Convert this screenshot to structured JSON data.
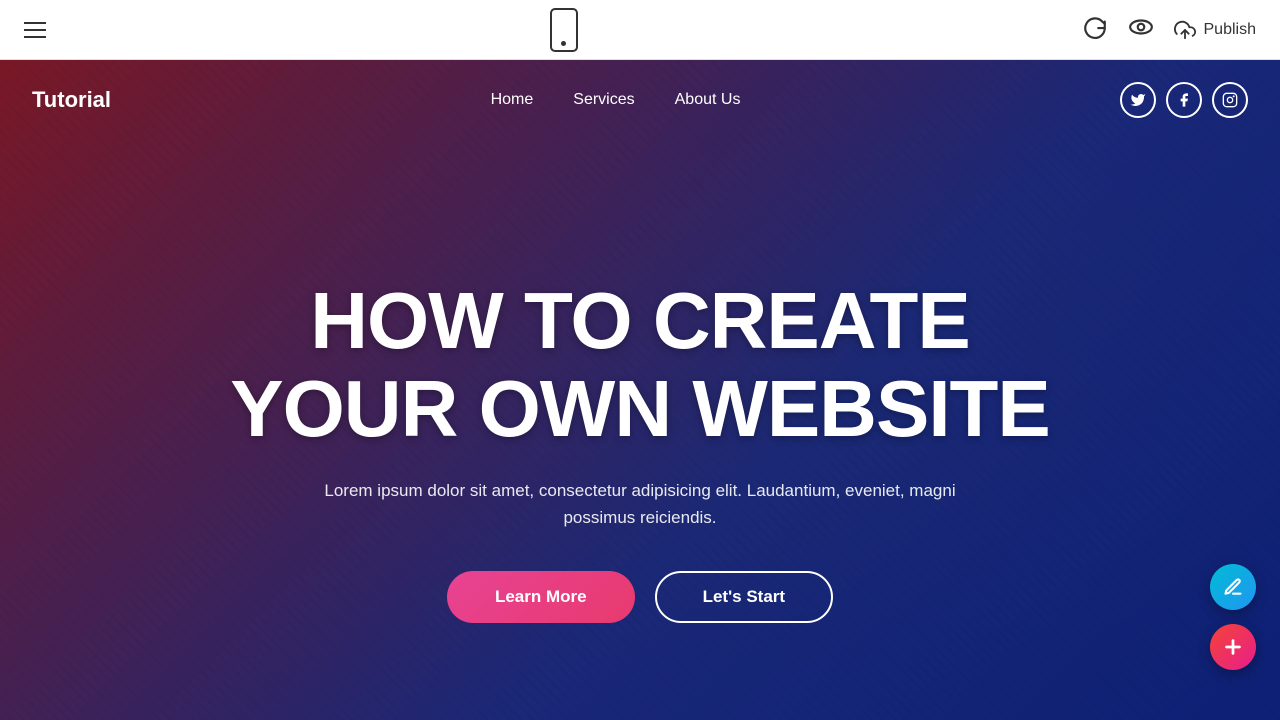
{
  "toolbar": {
    "hamburger_label": "menu",
    "mobile_view_label": "mobile view",
    "undo_label": "undo",
    "preview_label": "preview",
    "publish_label": "Publish"
  },
  "site": {
    "logo": "Tutorial",
    "nav": {
      "links": [
        {
          "id": "home",
          "label": "Home"
        },
        {
          "id": "services",
          "label": "Services"
        },
        {
          "id": "about",
          "label": "About Us"
        }
      ]
    },
    "social": [
      {
        "id": "twitter",
        "icon": "𝕏",
        "label": "Twitter"
      },
      {
        "id": "facebook",
        "icon": "f",
        "label": "Facebook"
      },
      {
        "id": "instagram",
        "icon": "📷",
        "label": "Instagram"
      }
    ]
  },
  "hero": {
    "title_line1": "HOW TO CREATE",
    "title_line2": "YOUR OWN WEBSITE",
    "subtitle": "Lorem ipsum dolor sit amet, consectetur adipisicing elit. Laudantium, eveniet, magni possimus reiciendis.",
    "btn_learn_more": "Learn More",
    "btn_lets_start": "Let's Start"
  },
  "fab": {
    "pencil_label": "edit",
    "plus_label": "add"
  }
}
